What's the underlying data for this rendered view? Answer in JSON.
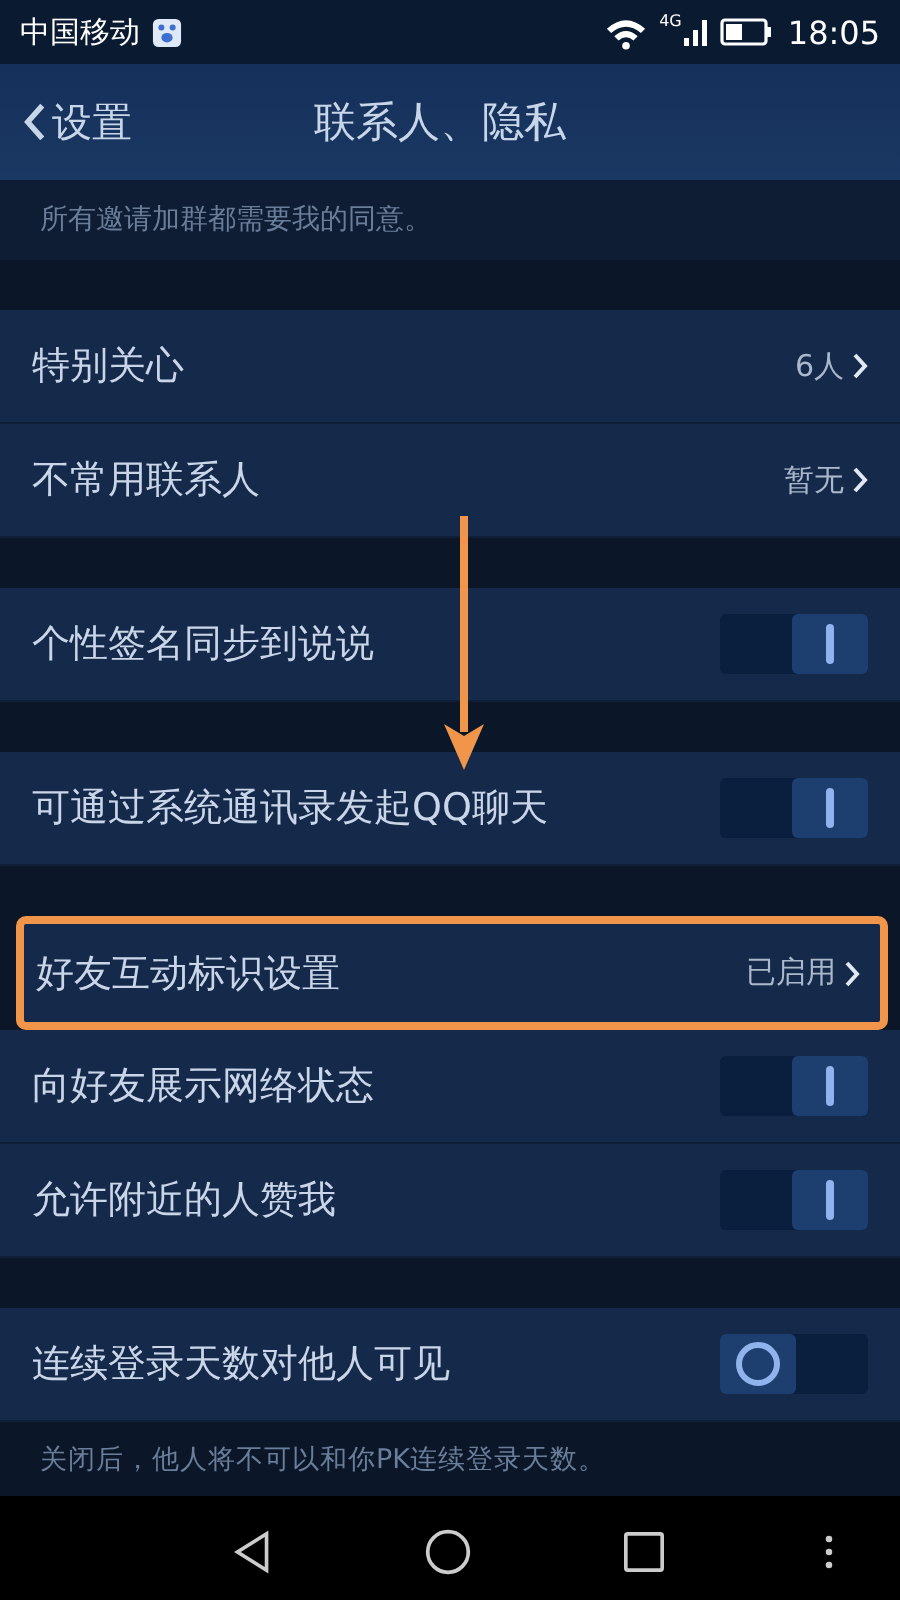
{
  "status_bar": {
    "carrier": "中国移动",
    "network": "4G",
    "time": "18:05"
  },
  "header": {
    "back": "设置",
    "title": "联系人、隐私"
  },
  "top_note": "所有邀请加群都需要我的同意。",
  "sections": [
    {
      "rows": [
        {
          "kind": "link",
          "label": "特别关心",
          "value": "6人",
          "highlighted": false
        },
        {
          "kind": "link",
          "label": "不常用联系人",
          "value": "暂无",
          "highlighted": false
        }
      ]
    },
    {
      "rows": [
        {
          "kind": "toggle",
          "label": "个性签名同步到说说",
          "on": true,
          "highlighted": false
        }
      ]
    },
    {
      "rows": [
        {
          "kind": "toggle",
          "label": "可通过系统通讯录发起QQ聊天",
          "on": true,
          "highlighted": false
        }
      ]
    },
    {
      "rows": [
        {
          "kind": "link",
          "label": "好友互动标识设置",
          "value": "已启用",
          "highlighted": true
        },
        {
          "kind": "toggle",
          "label": "向好友展示网络状态",
          "on": true,
          "highlighted": false
        },
        {
          "kind": "toggle",
          "label": "允许附近的人赞我",
          "on": true,
          "highlighted": false
        }
      ]
    },
    {
      "rows": [
        {
          "kind": "toggle",
          "label": "连续登录天数对他人可见",
          "on": false,
          "highlighted": false
        }
      ],
      "footer": "关闭后，他人将不可以和你PK连续登录天数。"
    }
  ]
}
